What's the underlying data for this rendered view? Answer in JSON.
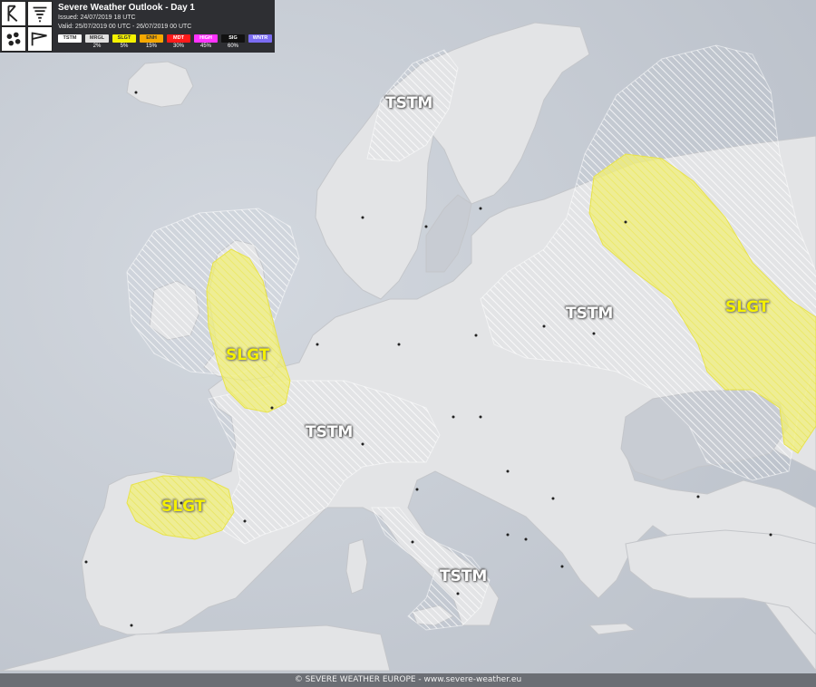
{
  "header": {
    "title": "Severe Weather Outlook - Day 1",
    "issued": "Issued: 24/07/2019 18 UTC",
    "valid": "Valid: 25/07/2019 00 UTC - 26/07/2019 00 UTC"
  },
  "legend": [
    {
      "code": "TSTM",
      "pct": "",
      "bg": "#ffffff",
      "fg": "#333333"
    },
    {
      "code": "MRGL",
      "pct": "2%",
      "bg": "#e0e0e0",
      "fg": "#333333"
    },
    {
      "code": "SLGT",
      "pct": "5%",
      "bg": "#f5f200",
      "fg": "#333333"
    },
    {
      "code": "ENH",
      "pct": "15%",
      "bg": "#f5a800",
      "fg": "#333333"
    },
    {
      "code": "MDT",
      "pct": "30%",
      "bg": "#ff1a1a",
      "fg": "#ffffff"
    },
    {
      "code": "HIGH",
      "pct": "45%",
      "bg": "#ff33ff",
      "fg": "#ffffff"
    },
    {
      "code": "SIG",
      "pct": "60%",
      "bg": "#111111",
      "fg": "#ffffff"
    },
    {
      "code": "WNTR",
      "pct": "",
      "bg": "#7b6cf2",
      "fg": "#ffffff"
    }
  ],
  "icons": [
    "hail-icon",
    "tornado-icon",
    "rain-icon",
    "wind-icon"
  ],
  "map": {
    "land_color": "#e4e5e7",
    "sea_color": "#c6cbd3",
    "tstm_color": "#ffffff",
    "slgt_color": "#f2f07a"
  },
  "labels": {
    "tstm_scandinavia": "TSTM",
    "tstm_east": "TSTM",
    "slgt_east": "SLGT",
    "slgt_uk": "SLGT",
    "tstm_france": "TSTM",
    "slgt_spain": "SLGT",
    "tstm_italy": "TSTM"
  },
  "footer": "© SEVERE WEATHER EUROPE - www.severe-weather.eu"
}
